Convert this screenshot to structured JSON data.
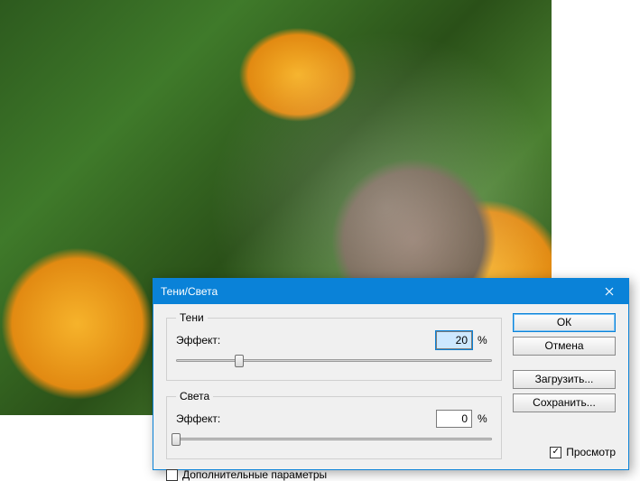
{
  "dialog": {
    "title": "Тени/Света",
    "shadows": {
      "legend": "Тени",
      "effect_label": "Эффект:",
      "value": "20",
      "percent": "%",
      "slider_position_pct": 20
    },
    "highlights": {
      "legend": "Света",
      "effect_label": "Эффект:",
      "value": "0",
      "percent": "%",
      "slider_position_pct": 0
    },
    "extra_params_label": "Дополнительные параметры",
    "extra_params_checked": false,
    "buttons": {
      "ok": "ОК",
      "cancel": "Отмена",
      "load": "Загрузить...",
      "save": "Сохранить..."
    },
    "preview": {
      "label": "Просмотр",
      "checked": true
    }
  }
}
